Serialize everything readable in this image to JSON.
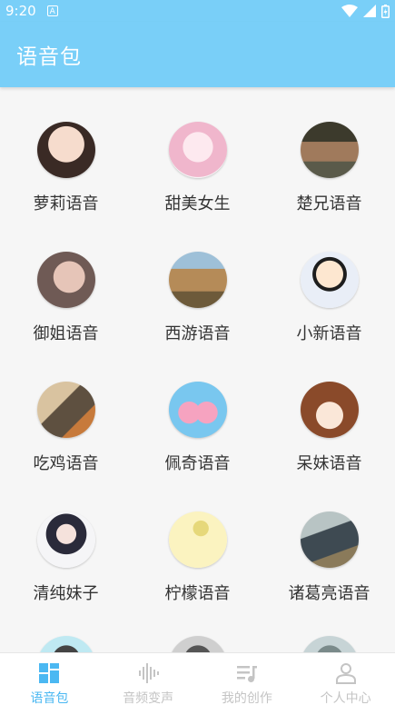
{
  "status": {
    "time": "9:20",
    "notif": "A"
  },
  "appbar": {
    "title": "语音包"
  },
  "items": [
    {
      "label": "萝莉语音",
      "avatar_color": "#e8c3b0"
    },
    {
      "label": "甜美女生",
      "avatar_color": "#f3d2e0"
    },
    {
      "label": "楚兄语音",
      "avatar_color": "#6c6a5c"
    },
    {
      "label": "御姐语音",
      "avatar_color": "#c9a99c"
    },
    {
      "label": "西游语音",
      "avatar_color": "#c2a36d"
    },
    {
      "label": "小新语音",
      "avatar_color": "#d9e3f2"
    },
    {
      "label": "吃鸡语音",
      "avatar_color": "#a08c6e"
    },
    {
      "label": "佩奇语音",
      "avatar_color": "#79c7ef"
    },
    {
      "label": "呆妹语音",
      "avatar_color": "#f2e3d7"
    },
    {
      "label": "清纯妹子",
      "avatar_color": "#f4f4f6"
    },
    {
      "label": "柠檬语音",
      "avatar_color": "#fbf3c0"
    },
    {
      "label": "诸葛亮语音",
      "avatar_color": "#8a9aa0"
    }
  ],
  "tabs": [
    {
      "label": "语音包",
      "icon": "grid-icon",
      "active": true
    },
    {
      "label": "音频变声",
      "icon": "waveform-icon",
      "active": false
    },
    {
      "label": "我的创作",
      "icon": "music-list-icon",
      "active": false
    },
    {
      "label": "个人中心",
      "icon": "person-icon",
      "active": false
    }
  ]
}
